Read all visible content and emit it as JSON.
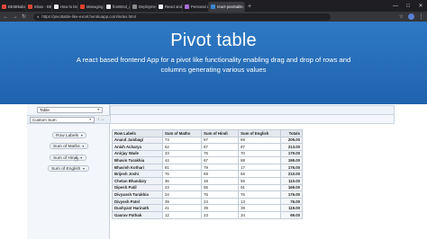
{
  "browser": {
    "tabs": [
      {
        "label": "BE5Bkaben3/6",
        "favicon": "#d9483b",
        "active": false
      },
      {
        "label": "Inbox - BE5...",
        "favicon": "#d44638",
        "active": false
      },
      {
        "label": "How to Deploy",
        "favicon": "#f1f1f1",
        "active": false
      },
      {
        "label": "Managing Dep",
        "favicon": "#e0422f",
        "active": false
      },
      {
        "label": "frontEnd_assign",
        "favicon": "#e8e8e8",
        "active": false
      },
      {
        "label": "Deployment",
        "favicon": "#8a8a8a",
        "active": false
      },
      {
        "label": "React and Redux",
        "favicon": "#f1f1f1",
        "active": false
      },
      {
        "label": "Personal app",
        "favicon": "#a66bd6",
        "active": false
      },
      {
        "label": "react-pivottable",
        "favicon": "#3a86d1",
        "active": true
      }
    ],
    "url": "https://pivottable-like-excel.herokuapp.com/index.html"
  },
  "hero": {
    "title": "Pivot table",
    "subtitle": "A react based frontend App for a pivot like functionality enabling drag and drop of rows and columns generating various values",
    "bg_color": "#2a72bd"
  },
  "pivot": {
    "renderer": "Table",
    "aggregator": "Custom Sum",
    "row_attrs": [
      "Row Labels",
      "Sum of Maths",
      "Sum of Hindi",
      "Sum of English"
    ],
    "table": {
      "headers": [
        "Row Labels",
        "Sum of Maths",
        "Sum of Hindi",
        "Sum of English",
        "Totals"
      ],
      "rows": [
        [
          "Anand Jambagi",
          "73",
          "67",
          "69",
          "209.00"
        ],
        [
          "Anish Acharya",
          "62",
          "87",
          "87",
          "213.00"
        ],
        [
          "Anirjay Wade",
          "33",
          "76",
          "70",
          "179.00"
        ],
        [
          "Bhavin Turakhia",
          "44",
          "67",
          "88",
          "199.00"
        ],
        [
          "Bhavish Kothari",
          "81",
          "79",
          "17",
          "176.00"
        ],
        [
          "Brijesh Joshi",
          "76",
          "69",
          "65",
          "210.00"
        ],
        [
          "Chetan Bhandary",
          "36",
          "18",
          "56",
          "110.00"
        ],
        [
          "Dipesh Patil",
          "23",
          "55",
          "91",
          "169.00"
        ],
        [
          "Divyansh Turakhia",
          "24",
          "76",
          "76",
          "176.00"
        ],
        [
          "Divyesh Patel",
          "39",
          "24",
          "13",
          "76.00"
        ],
        [
          "Dushyant Harinath",
          "41",
          "39",
          "39",
          "119.00"
        ],
        [
          "Gaurav Pathak",
          "12",
          "23",
          "34",
          "69.00"
        ]
      ]
    }
  }
}
